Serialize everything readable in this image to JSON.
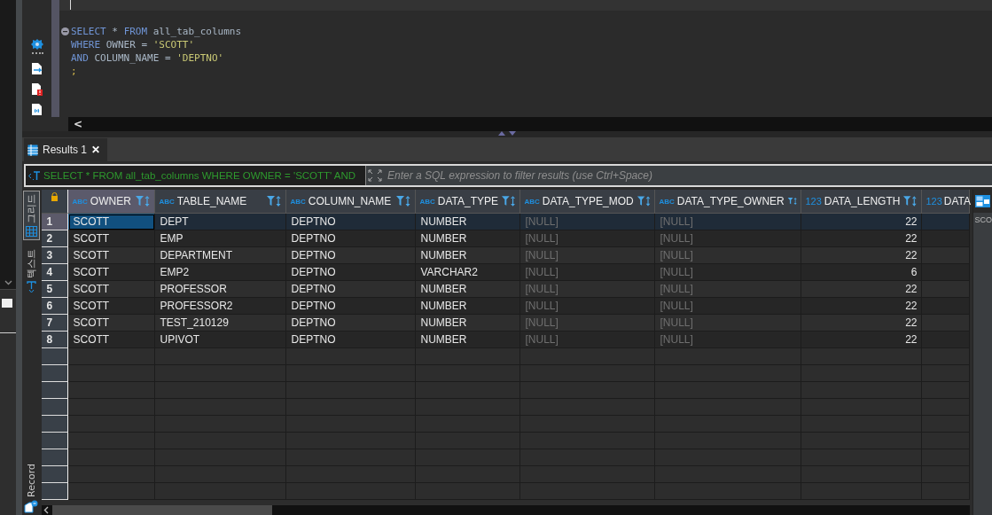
{
  "editor": {
    "lines": [
      {
        "tokens": [
          {
            "kind": "keyword",
            "text": "SELECT"
          },
          {
            "kind": "text",
            "text": " * "
          },
          {
            "kind": "keyword",
            "text": "FROM"
          },
          {
            "kind": "text",
            "text": " all_tab_columns"
          }
        ]
      },
      {
        "tokens": [
          {
            "kind": "keyword",
            "text": "WHERE"
          },
          {
            "kind": "text",
            "text": " OWNER = "
          },
          {
            "kind": "string",
            "text": "'SCOTT'"
          }
        ]
      },
      {
        "tokens": [
          {
            "kind": "keyword",
            "text": "AND"
          },
          {
            "kind": "text",
            "text": " COLUMN_NAME = "
          },
          {
            "kind": "string",
            "text": "'DEPTNO'"
          }
        ]
      },
      {
        "tokens": [
          {
            "kind": "punct",
            "text": ";"
          }
        ]
      }
    ],
    "scroll_left": "<"
  },
  "results_tabs": [
    {
      "label": "Results 1",
      "selected": true,
      "close": "✕"
    }
  ],
  "filter": {
    "query": "SELECT * FROM all_tab_columns WHERE OWNER = 'SCOTT' AND",
    "placeholder": "Enter a SQL expression to filter results (use Ctrl+Space)"
  },
  "side_tabs": [
    {
      "label": "그리드",
      "selected": true
    },
    {
      "label": "텍스트",
      "selected": false
    }
  ],
  "record_toggle": {
    "label": "Record"
  },
  "columns": [
    {
      "name": "OWNER",
      "type_label": "ABC",
      "kind": "text",
      "filter": true,
      "selected": true
    },
    {
      "name": "TABLE_NAME",
      "type_label": "ABC",
      "kind": "text",
      "filter": true,
      "selected": false
    },
    {
      "name": "COLUMN_NAME",
      "type_label": "ABC",
      "kind": "text",
      "filter": true,
      "selected": false
    },
    {
      "name": "DATA_TYPE",
      "type_label": "ABC",
      "kind": "text",
      "filter": true,
      "selected": false
    },
    {
      "name": "DATA_TYPE_MOD",
      "type_label": "ABC",
      "kind": "text",
      "filter": true,
      "selected": false
    },
    {
      "name": "DATA_TYPE_OWNER",
      "type_label": "ABC",
      "kind": "text",
      "filter": true,
      "selected": false
    },
    {
      "name": "DATA_LENGTH",
      "type_label": "123",
      "kind": "number",
      "filter": true,
      "selected": false
    },
    {
      "name": "DATA",
      "type_label": "123",
      "kind": "number",
      "filter": false,
      "selected": false
    }
  ],
  "rows": [
    {
      "number": "1",
      "selected": true,
      "cells": [
        {
          "text": "SCOTT",
          "null": false,
          "selected": true
        },
        {
          "text": "DEPT",
          "null": false,
          "selected": false
        },
        {
          "text": "DEPTNO",
          "null": false,
          "selected": false
        },
        {
          "text": "NUMBER",
          "null": false,
          "selected": false
        },
        {
          "text": "[NULL]",
          "null": true,
          "selected": false
        },
        {
          "text": "[NULL]",
          "null": true,
          "selected": false
        },
        {
          "text": "22",
          "null": false,
          "selected": false
        }
      ]
    },
    {
      "number": "2",
      "selected": false,
      "cells": [
        {
          "text": "SCOTT",
          "null": false,
          "selected": false
        },
        {
          "text": "EMP",
          "null": false,
          "selected": false
        },
        {
          "text": "DEPTNO",
          "null": false,
          "selected": false
        },
        {
          "text": "NUMBER",
          "null": false,
          "selected": false
        },
        {
          "text": "[NULL]",
          "null": true,
          "selected": false
        },
        {
          "text": "[NULL]",
          "null": true,
          "selected": false
        },
        {
          "text": "22",
          "null": false,
          "selected": false
        }
      ]
    },
    {
      "number": "3",
      "selected": false,
      "cells": [
        {
          "text": "SCOTT",
          "null": false,
          "selected": false
        },
        {
          "text": "DEPARTMENT",
          "null": false,
          "selected": false
        },
        {
          "text": "DEPTNO",
          "null": false,
          "selected": false
        },
        {
          "text": "NUMBER",
          "null": false,
          "selected": false
        },
        {
          "text": "[NULL]",
          "null": true,
          "selected": false
        },
        {
          "text": "[NULL]",
          "null": true,
          "selected": false
        },
        {
          "text": "22",
          "null": false,
          "selected": false
        }
      ]
    },
    {
      "number": "4",
      "selected": false,
      "cells": [
        {
          "text": "SCOTT",
          "null": false,
          "selected": false
        },
        {
          "text": "EMP2",
          "null": false,
          "selected": false
        },
        {
          "text": "DEPTNO",
          "null": false,
          "selected": false
        },
        {
          "text": "VARCHAR2",
          "null": false,
          "selected": false
        },
        {
          "text": "[NULL]",
          "null": true,
          "selected": false
        },
        {
          "text": "[NULL]",
          "null": true,
          "selected": false
        },
        {
          "text": "6",
          "null": false,
          "selected": false
        }
      ]
    },
    {
      "number": "5",
      "selected": false,
      "cells": [
        {
          "text": "SCOTT",
          "null": false,
          "selected": false
        },
        {
          "text": "PROFESSOR",
          "null": false,
          "selected": false
        },
        {
          "text": "DEPTNO",
          "null": false,
          "selected": false
        },
        {
          "text": "NUMBER",
          "null": false,
          "selected": false
        },
        {
          "text": "[NULL]",
          "null": true,
          "selected": false
        },
        {
          "text": "[NULL]",
          "null": true,
          "selected": false
        },
        {
          "text": "22",
          "null": false,
          "selected": false
        }
      ]
    },
    {
      "number": "6",
      "selected": false,
      "cells": [
        {
          "text": "SCOTT",
          "null": false,
          "selected": false
        },
        {
          "text": "PROFESSOR2",
          "null": false,
          "selected": false
        },
        {
          "text": "DEPTNO",
          "null": false,
          "selected": false
        },
        {
          "text": "NUMBER",
          "null": false,
          "selected": false
        },
        {
          "text": "[NULL]",
          "null": true,
          "selected": false
        },
        {
          "text": "[NULL]",
          "null": true,
          "selected": false
        },
        {
          "text": "22",
          "null": false,
          "selected": false
        }
      ]
    },
    {
      "number": "7",
      "selected": false,
      "cells": [
        {
          "text": "SCOTT",
          "null": false,
          "selected": false
        },
        {
          "text": "TEST_210129",
          "null": false,
          "selected": false
        },
        {
          "text": "DEPTNO",
          "null": false,
          "selected": false
        },
        {
          "text": "NUMBER",
          "null": false,
          "selected": false
        },
        {
          "text": "[NULL]",
          "null": true,
          "selected": false
        },
        {
          "text": "[NULL]",
          "null": true,
          "selected": false
        },
        {
          "text": "22",
          "null": false,
          "selected": false
        }
      ]
    },
    {
      "number": "8",
      "selected": false,
      "cells": [
        {
          "text": "SCOTT",
          "null": false,
          "selected": false
        },
        {
          "text": "UPIVOT",
          "null": false,
          "selected": false
        },
        {
          "text": "DEPTNO",
          "null": false,
          "selected": false
        },
        {
          "text": "NUMBER",
          "null": false,
          "selected": false
        },
        {
          "text": "[NULL]",
          "null": true,
          "selected": false
        },
        {
          "text": "[NULL]",
          "null": true,
          "selected": false
        },
        {
          "text": "22",
          "null": false,
          "selected": false
        }
      ]
    }
  ],
  "side_panel": {
    "text": "SCO"
  }
}
